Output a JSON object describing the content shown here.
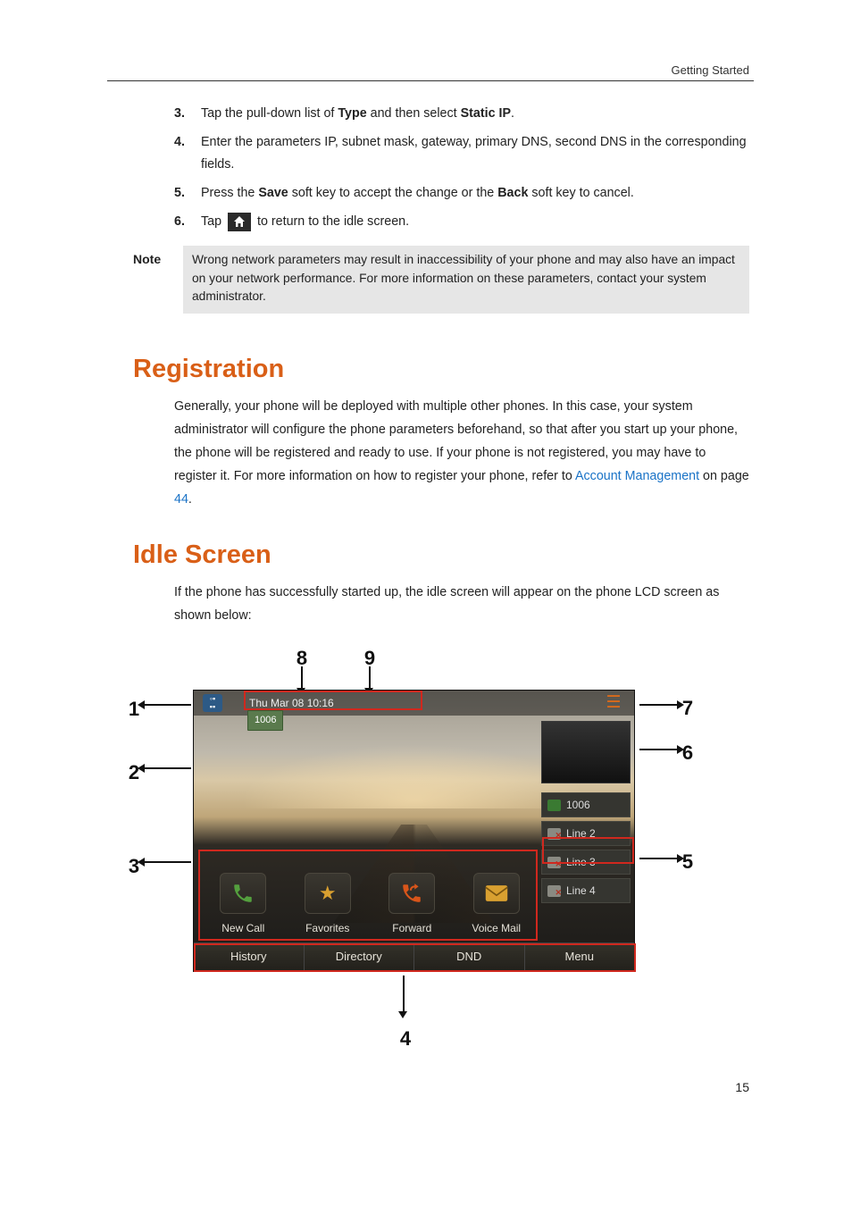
{
  "header": {
    "section": "Getting Started"
  },
  "steps": {
    "s3_num": "3.",
    "s3_a": "Tap the pull-down list of ",
    "s3_b": "Type",
    "s3_c": " and then select ",
    "s3_d": "Static IP",
    "s3_e": ".",
    "s4_num": "4.",
    "s4": "Enter the parameters IP, subnet mask, gateway, primary DNS, second DNS in the corresponding fields.",
    "s5_num": "5.",
    "s5_a": "Press the ",
    "s5_b": "Save",
    "s5_c": " soft key to accept the change or the ",
    "s5_d": "Back",
    "s5_e": " soft key to cancel.",
    "s6_num": "6.",
    "s6_a": "Tap ",
    "s6_b": " to return to the idle screen."
  },
  "note": {
    "label": "Note",
    "text": "Wrong network parameters may result in inaccessibility of your phone and may also have an impact on your network performance. For more information on these parameters, contact your system administrator."
  },
  "registration": {
    "heading": "Registration",
    "body_a": "Generally, your phone will be deployed with multiple other phones. In this case, your system administrator will configure the phone parameters beforehand, so that after you start up your phone, the phone will be registered and ready to use. If your phone is not registered, you may have to register it. For more information on how to register your phone, refer to ",
    "link": "Account Management",
    "body_b": " on page ",
    "page_ref": "44",
    "body_c": "."
  },
  "idle": {
    "heading": "Idle Screen",
    "body": "If the phone has successfully started up, the idle screen will appear on the phone LCD screen as shown below:"
  },
  "phone": {
    "datetime": "Thu Mar 08 10:16",
    "active_line": "1006",
    "lines": [
      "1006",
      "Line 2",
      "Line 3",
      "Line 4"
    ],
    "quick": [
      "New Call",
      "Favorites",
      "Forward",
      "Voice Mail"
    ],
    "soft": [
      "History",
      "Directory",
      "DND",
      "Menu"
    ]
  },
  "callouts": {
    "c1": "1",
    "c2": "2",
    "c3": "3",
    "c4": "4",
    "c5": "5",
    "c6": "6",
    "c7": "7",
    "c8": "8",
    "c9": "9"
  },
  "pagenum": "15"
}
